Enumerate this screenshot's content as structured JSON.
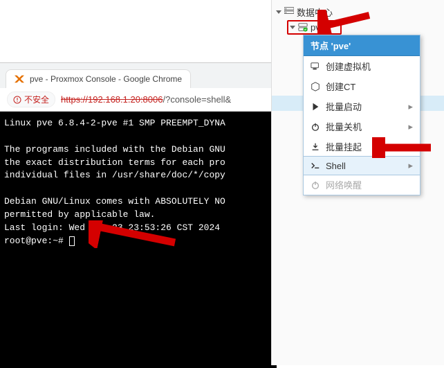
{
  "browser": {
    "tab_title": "pve - Proxmox Console - Google Chrome",
    "insecure_label": "不安全",
    "url_host": "https://192.168.1.20:8006",
    "url_rest": "/?console=shell&"
  },
  "terminal": {
    "line1": "Linux pve 6.8.4-2-pve #1 SMP PREEMPT_DYNA",
    "line2": "",
    "line3": "The programs included with the Debian GNU",
    "line4": "the exact distribution terms for each pro",
    "line5": "individual files in /usr/share/doc/*/copy",
    "line6": "",
    "line7": "Debian GNU/Linux comes with ABSOLUTELY NO",
    "line8": "permitted by applicable law.",
    "line9": "Last login: Wed Oct 23 23:53:26 CST 2024 ",
    "prompt": "root@pve:~# "
  },
  "sidebar": {
    "datacenter": "数据中心",
    "node": "pve",
    "storages": [
      "",
      "",
      "",
      "",
      ""
    ]
  },
  "menu": {
    "title": "节点 'pve'",
    "create_vm": "创建虚拟机",
    "create_ct": "创建CT",
    "bulk_start": "批量启动",
    "bulk_stop": "批量关机",
    "bulk_suspend": "批量挂起",
    "shell": "Shell",
    "wol": "网络唤醒"
  }
}
